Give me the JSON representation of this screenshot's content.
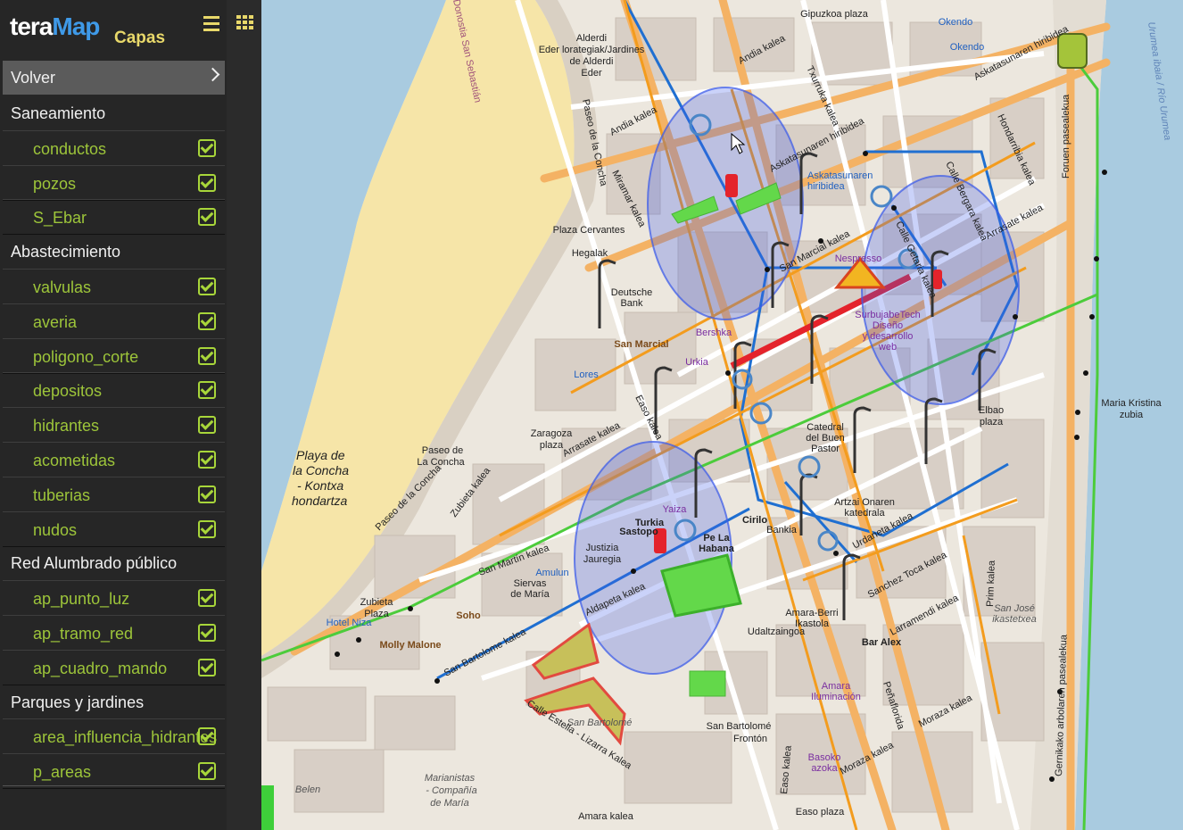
{
  "app": {
    "logo_tera": "tera",
    "logo_map": "Map",
    "panel_title": "Capas"
  },
  "sidebar": {
    "back_label": "Volver",
    "groups": [
      {
        "label": "Saneamiento"
      },
      {
        "label": "Abastecimiento"
      },
      {
        "label": "Red Alumbrado público"
      },
      {
        "label": "Parques y jardines"
      }
    ],
    "layers": [
      {
        "label": "conductos",
        "checked": true
      },
      {
        "label": "pozos",
        "checked": true
      },
      {
        "label": "S_Ebar",
        "checked": true
      },
      {
        "label": "valvulas",
        "checked": true
      },
      {
        "label": "averia",
        "checked": true
      },
      {
        "label": "poligono_corte",
        "checked": true
      },
      {
        "label": "depositos",
        "checked": true
      },
      {
        "label": "hidrantes",
        "checked": true
      },
      {
        "label": "acometidas",
        "checked": true
      },
      {
        "label": "tuberias",
        "checked": true
      },
      {
        "label": "nudos",
        "checked": true
      },
      {
        "label": "ap_punto_luz",
        "checked": true
      },
      {
        "label": "ap_tramo_red",
        "checked": true
      },
      {
        "label": "ap_cuadro_mando",
        "checked": true
      },
      {
        "label": "area_influencia_hidrantes",
        "checked": true
      },
      {
        "label": "p_areas",
        "checked": true
      }
    ]
  },
  "map": {
    "labels": {
      "playa1": "Playa de",
      "playa2": "la Concha",
      "playa3": "- Kontxa",
      "playa4": "hondartza",
      "alderdi1": "Alderdi",
      "alderdi2": "Eder lorategiak/Jardines",
      "alderdi3": "de Alderdi",
      "alderdi4": "Eder",
      "plaza_cervantes": "Plaza Cervantes",
      "hegalak": "Hegalak",
      "deutsche1": "Deutsche",
      "deutsche2": "Bank",
      "san_marcial": "San Marcial",
      "zaragoza1": "Zaragoza",
      "zaragoza2": "plaza",
      "paseo_concha1": "Paseo de",
      "paseo_concha2": "La Concha",
      "paseo_concha_street": "Paseo de la Concha",
      "zubieta1": "Zubieta",
      "zubieta2": "Plaza",
      "hotel_niza": "Hotel Niza",
      "molly": "Molly Malone",
      "soho": "Soho",
      "siervas1": "Siervas",
      "siervas2": "de María",
      "amulun": "Amulun",
      "justizia1": "Justizia",
      "justizia2": "Jauregia",
      "turkia1": "Turkia",
      "turkia2": "Sastopo",
      "yaiza": "Yaiza",
      "habana1": "Pe La",
      "habana2": "Habana",
      "cirilo": "Cirilo",
      "bankia": "Bankia",
      "urkia": "Urkia",
      "bershka": "Bershka",
      "nespresso": "Nespresso",
      "surbu1": "SurbujabeTech",
      "surbu2": "Diseño",
      "surbu3": "y desarrollo",
      "surbu4": "web",
      "catedral1": "Catedral",
      "catedral2": "del Buen",
      "catedral3": "Pastor",
      "artzai1": "Artzai Onaren",
      "artzai2": "katedrala",
      "amara1": "Amara-Berri",
      "amara2": "Ikastola",
      "bar_alex": "Bar Alex",
      "amara_il1": "Amara",
      "amara_il2": "Iluminación",
      "san_bartolome": "San Bartolomé",
      "sb_fronton1": "San Bartolomé",
      "sb_fronton2": "Frontón",
      "marianistas1": "Marianistas",
      "marianistas2": "- Compañía",
      "marianistas3": "de María",
      "belen": "Belen",
      "easo_plaza": "Easo plaza",
      "amara_kalea": "Amara kalea",
      "maria_cristina1": "Maria Kristina",
      "maria_cristina2": "zubia",
      "urumea": "Urumea ibaia / Río Urumea",
      "okendo": "Okendo",
      "gipuzkoa": "Gipuzkoa plaza",
      "andia": "Andia kalea",
      "miramar": "Miramar kalea",
      "askatasunaren1": "Askatasunaren hiribidea",
      "askatasunaren2": "Askatasunaren hiribidea",
      "askatasunaren3": "Askatasunaren",
      "askatasunaren4": "hiribidea",
      "arrasate": "Arrasate kalea",
      "zubieta_kalea": "Zubieta kalea",
      "san_martin": "San Martín kalea",
      "aldapeta": "Aldapeta kalea",
      "san_bartolome_k": "San Bartolome kalea",
      "urdaneta": "Urdaneta kalea",
      "sanchez_toca": "Sanchez Toca kalea",
      "larramendi": "Larramendi kalea",
      "moraza": "Moraza kalea",
      "prim": "Prim kalea",
      "fueros": "Foruen pasealekua",
      "gernika": "Gernikako arbolaren pasealekua",
      "easo_kalea": "Easo kalea",
      "getaria": "Calle Getaria kalea",
      "bergara": "Calle Bergara kalea",
      "estella": "Calle Estella - Lizarra Kalea",
      "hondarribia": "Hondarribia kalea",
      "sanjose1": "San José",
      "sanjose2": "ikastetxea",
      "oquendo_k": "Okendo",
      "zaingoa": "Udaltzaingoa",
      "txurruka": "Txurruka kalea",
      "san_marcial_k": "San Marcial kalea",
      "calle_easo": "Easo kalea",
      "peñaflorida": "Peñaflorida",
      "donosti": "Donostia San Sebastián",
      "paseo_concha_v": "Paseo de la Concha",
      "lores": "Lores",
      "basoko": "Basoko",
      "azoka": "azoka",
      "elbao": "Elbao",
      "plaza_small": "plaza"
    }
  }
}
